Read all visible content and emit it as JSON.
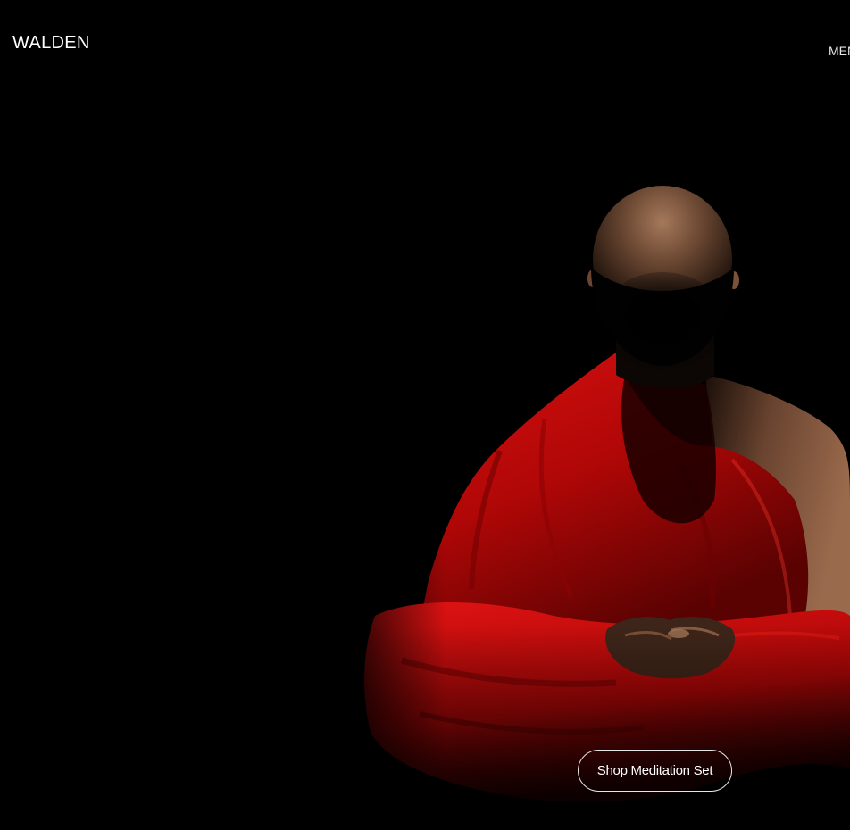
{
  "header": {
    "logo_text": "WALDEN",
    "menu_label": "MENU"
  },
  "hero": {
    "image_subject": "meditating-monk-in-red-robe",
    "cta_label": "Shop Meditation Set"
  },
  "colors": {
    "background": "#000000",
    "robe_red": "#c40808",
    "text": "#ffffff",
    "button_border": "#e6e6e6"
  }
}
